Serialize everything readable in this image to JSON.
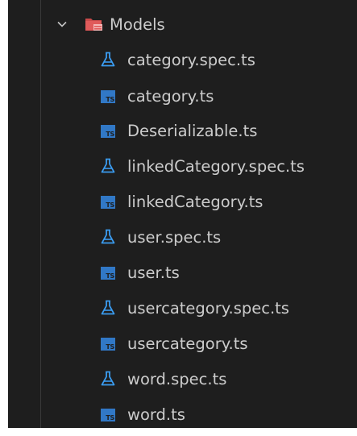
{
  "explorer": {
    "folder": {
      "label": "Models",
      "icon": "folder-open-red-icon",
      "expanded": true
    },
    "files": [
      {
        "label": "category.spec.ts",
        "icon": "test-flask-icon"
      },
      {
        "label": "category.ts",
        "icon": "typescript-icon"
      },
      {
        "label": "Deserializable.ts",
        "icon": "typescript-icon"
      },
      {
        "label": "linkedCategory.spec.ts",
        "icon": "test-flask-icon"
      },
      {
        "label": "linkedCategory.ts",
        "icon": "typescript-icon"
      },
      {
        "label": "user.spec.ts",
        "icon": "test-flask-icon"
      },
      {
        "label": "user.ts",
        "icon": "typescript-icon"
      },
      {
        "label": "usercategory.spec.ts",
        "icon": "test-flask-icon"
      },
      {
        "label": "usercategory.ts",
        "icon": "typescript-icon"
      },
      {
        "label": "word.spec.ts",
        "icon": "test-flask-icon"
      },
      {
        "label": "word.ts",
        "icon": "typescript-icon"
      }
    ],
    "ts_badge": "TS"
  },
  "colors": {
    "background": "#1e1e1e",
    "text": "#cccccc",
    "test_icon": "#3b9cf0",
    "ts_icon": "#3178c6",
    "folder_icon": "#e55b5b"
  }
}
